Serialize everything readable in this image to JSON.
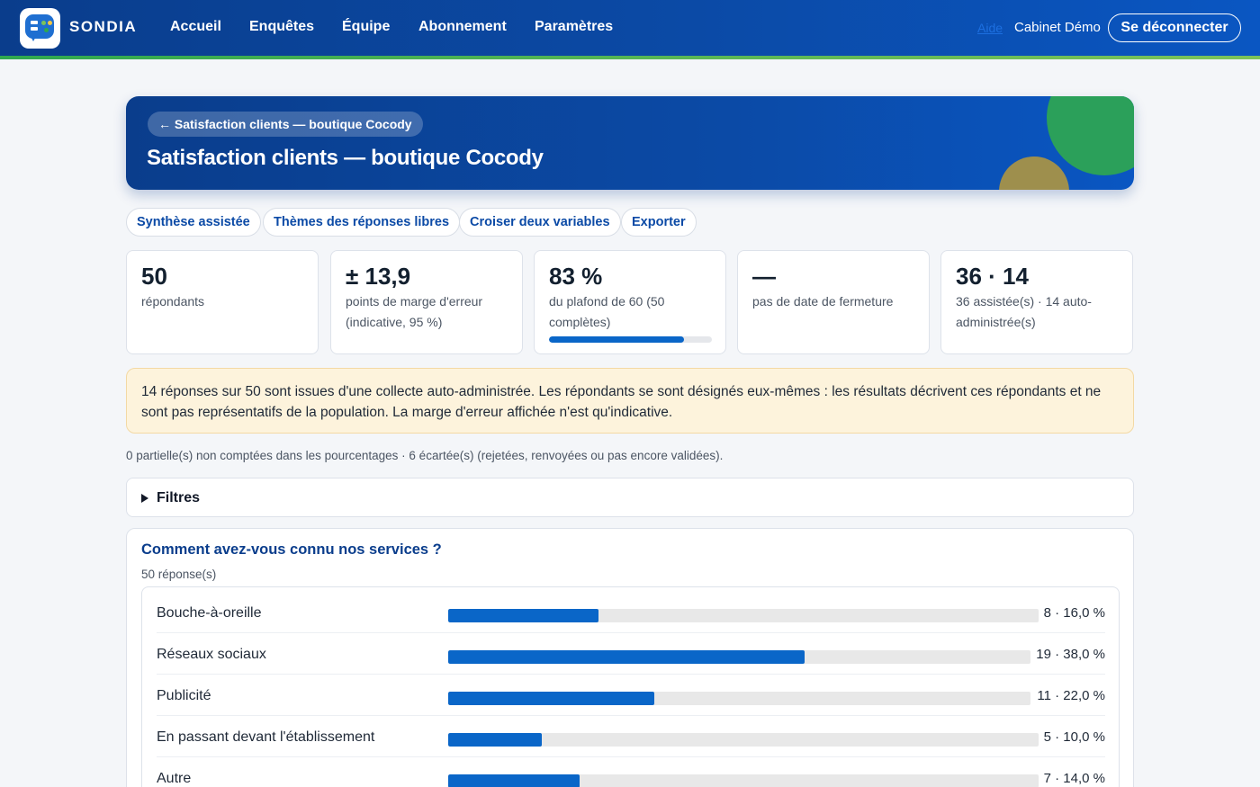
{
  "app": {
    "brand": "SONDIA",
    "nav": [
      "Accueil",
      "Enquêtes",
      "Équipe",
      "Abonnement",
      "Paramètres"
    ],
    "aide_label": "Aide",
    "account_name": "Cabinet Démo",
    "logout_label": "Se déconnecter"
  },
  "survey": {
    "back_label": "← Satisfaction clients — boutique Cocody",
    "title": "Satisfaction clients — boutique Cocody"
  },
  "actions": [
    "Synthèse assistée",
    "Thèmes des réponses libres",
    "Croiser deux variables",
    "Exporter"
  ],
  "stats": [
    {
      "value": "50",
      "label": "répondants"
    },
    {
      "value": "± 13,9",
      "label": "points de marge d'erreur (indicative, 95 %)"
    },
    {
      "value": "83 %",
      "label": "du plafond de 60 (50 complètes)",
      "progress": 0.83
    },
    {
      "value": "—",
      "label": "pas de date de fermeture"
    },
    {
      "value": "36 · 14",
      "label": "36 assistée(s) · 14 auto-administrée(s)"
    }
  ],
  "warning": "14 réponses sur 50 sont issues d'une collecte auto-administrée. Les répondants se sont désignés eux-mêmes : les résultats décrivent ces répondants et ne sont pas représentatifs de la population. La marge d'erreur affichée n'est qu'indicative.",
  "note": "0 partielle(s) non comptées dans les pourcentages · 6 écartée(s) (rejetées, renvoyées ou pas encore validées).",
  "filters_label": "Filtres",
  "question": {
    "title": "Comment avez-vous connu nos services ?",
    "count": "50 réponse(s)",
    "answers": [
      {
        "label": "Bouche-à-oreille",
        "value": "8 · 16,0 %",
        "fraction": 0.16
      },
      {
        "label": "Réseaux sociaux",
        "value": "19 · 38,0 %",
        "fraction": 0.38
      },
      {
        "label": "Publicité",
        "value": "11 · 22,0 %",
        "fraction": 0.22
      },
      {
        "label": "En passant devant l'établissement",
        "value": "5 · 10,0 %",
        "fraction": 0.1
      },
      {
        "label": "Autre",
        "value": "7 · 14,0 %",
        "fraction": 0.14
      }
    ]
  }
}
